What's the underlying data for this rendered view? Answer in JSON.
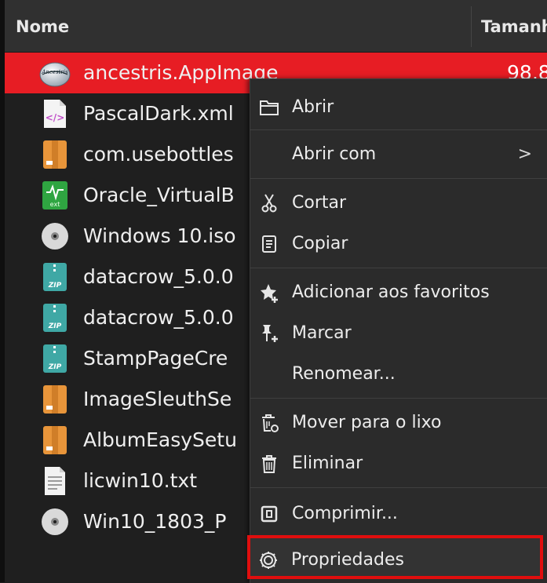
{
  "header": {
    "name_label": "Nome",
    "size_label": "Tamanh"
  },
  "files": [
    {
      "name": "ancestris.AppImage",
      "size": "98,8",
      "icon": "ancestris-app-icon",
      "selected": true
    },
    {
      "name": "PascalDark.xml",
      "icon": "xml-file-icon"
    },
    {
      "name": "com.usebottles",
      "icon": "package-icon"
    },
    {
      "name": "Oracle_VirtualB",
      "icon": "extension-icon"
    },
    {
      "name": "Windows 10.iso",
      "icon": "disc-icon"
    },
    {
      "name": "datacrow_5.0.0",
      "icon": "zip-icon"
    },
    {
      "name": "datacrow_5.0.0",
      "icon": "zip-icon"
    },
    {
      "name": "StampPageCre",
      "icon": "zip-icon"
    },
    {
      "name": "ImageSleuthSe",
      "icon": "package-icon"
    },
    {
      "name": "AlbumEasySetu",
      "icon": "package-icon"
    },
    {
      "name": "licwin10.txt",
      "icon": "text-file-icon"
    },
    {
      "name": "Win10_1803_P",
      "icon": "disc-icon"
    }
  ],
  "menu": {
    "abrir": "Abrir",
    "abrir_com": "Abrir com",
    "submenu_arrow": ">",
    "cortar": "Cortar",
    "copiar": "Copiar",
    "favoritos": "Adicionar aos favoritos",
    "marcar": "Marcar",
    "renomear": "Renomear...",
    "lixo": "Mover para o lixo",
    "eliminar": "Eliminar",
    "comprimir": "Comprimir...",
    "propriedades": "Propriedades"
  },
  "colors": {
    "selection": "#e71d24",
    "highlight_border": "#e00e0e",
    "menu_bg": "#2b2b2b"
  }
}
